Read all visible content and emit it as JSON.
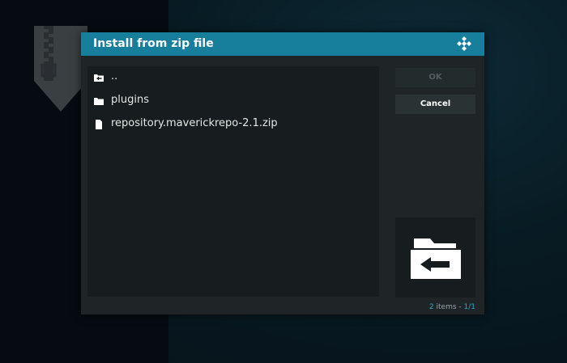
{
  "dialog": {
    "title": "Install from zip file",
    "logo_icon": "kodi-logo-icon",
    "header_color": "#177f9c"
  },
  "files": [
    {
      "label": "..",
      "icon": "parent-folder-icon"
    },
    {
      "label": "plugins",
      "icon": "folder-icon"
    },
    {
      "label": "repository.maverickrepo-2.1.zip",
      "icon": "file-icon"
    }
  ],
  "buttons": {
    "ok": "OK",
    "cancel": "Cancel"
  },
  "thumbnail": {
    "icon": "folder-back-arrow-icon"
  },
  "footer": {
    "item_count": "2",
    "items_word": " items - ",
    "page": "1/1"
  },
  "background": {
    "icon": "zip-archive-icon"
  }
}
